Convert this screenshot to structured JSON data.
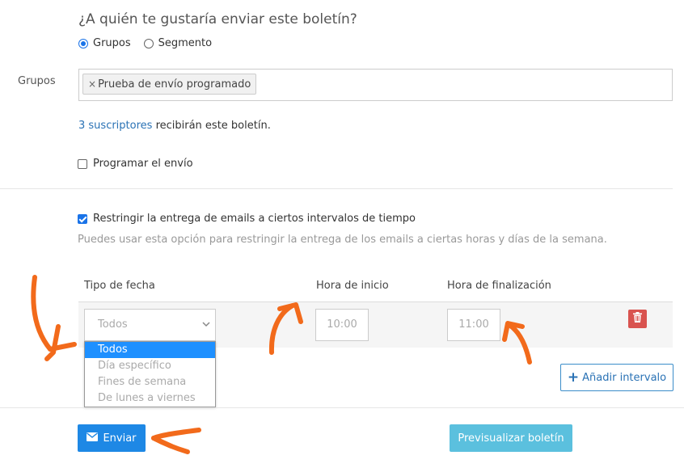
{
  "question": "¿A quién te gustaría enviar este boletín?",
  "recipient_mode": {
    "options": [
      "Grupos",
      "Segmento"
    ],
    "selected": "Grupos"
  },
  "groups": {
    "label": "Grupos",
    "tags": [
      {
        "remove_icon": "×",
        "label": "Prueba de envío programado"
      }
    ]
  },
  "subscribers": {
    "link": "3 suscriptores",
    "text": " recibirán este boletín."
  },
  "schedule": {
    "label": "Programar el envío",
    "checked": false
  },
  "restrict": {
    "label": "Restringir la entrega de emails a ciertos intervalos de tiempo",
    "checked": true,
    "hint": "Puedes usar esta opción para restringir la entrega de los emails a ciertas horas y días de la semana."
  },
  "table": {
    "headers": {
      "date_type": "Tipo de fecha",
      "start": "Hora de inicio",
      "end": "Hora de finalización"
    },
    "row": {
      "date_type_value": "Todos",
      "start_time": "10:00",
      "end_time": "11:00"
    },
    "dropdown_options": [
      "Todos",
      "Día específico",
      "Fines de semana",
      "De lunes a viernes"
    ],
    "dropdown_selected": "Todos"
  },
  "buttons": {
    "add_interval": "Añadir intervalo",
    "send": "Enviar",
    "preview": "Previsualizar boletín"
  },
  "colors": {
    "primary": "#1e88e5",
    "info": "#5bc0de",
    "danger": "#d9534f",
    "annotation_arrow": "#f26a1b"
  }
}
